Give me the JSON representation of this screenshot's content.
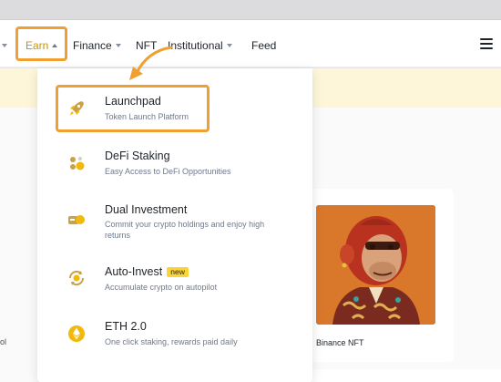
{
  "nav": {
    "items": [
      {
        "label": "Earn",
        "caret": "up",
        "active": true
      },
      {
        "label": "Finance",
        "caret": "down"
      },
      {
        "label": "NFT"
      },
      {
        "label": "Institutional",
        "caret": "down"
      },
      {
        "label": "Feed"
      }
    ],
    "menu_icon": "hamburger-menu-icon",
    "highlight_color": "#F0A030",
    "active_color": "#C99400"
  },
  "dropdown": {
    "items": [
      {
        "title": "Launchpad",
        "subtitle": "Token Launch Platform",
        "icon": "rocket-icon",
        "highlighted": true
      },
      {
        "title": "DeFi Staking",
        "subtitle": "Easy Access to DeFi Opportunities",
        "icon": "defi-staking-icon"
      },
      {
        "title": "Dual Investment",
        "subtitle": "Commit your crypto holdings and enjoy high returns",
        "icon": "dual-investment-icon"
      },
      {
        "title": "Auto-Invest",
        "badge": "new",
        "subtitle": "Accumulate crypto on autopilot",
        "icon": "auto-invest-icon"
      },
      {
        "title": "ETH 2.0",
        "subtitle": "One click staking, rewards paid daily",
        "icon": "ethereum-icon"
      }
    ]
  },
  "background": {
    "left_fragment": "ol",
    "nft_card": {
      "label": "Binance NFT",
      "image": "ape-nft-illustration"
    }
  },
  "colors": {
    "brand_yellow": "#FCD535",
    "banner": "#FEF6D8",
    "nft_bg": "#D9772B"
  }
}
